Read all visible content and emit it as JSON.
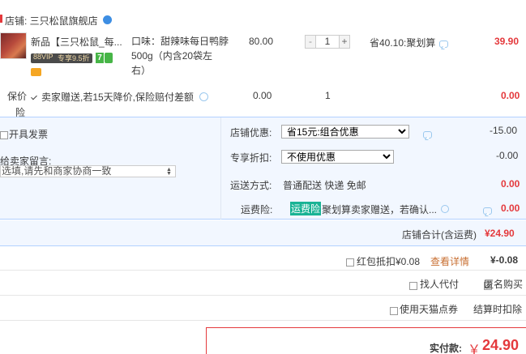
{
  "shop": {
    "label": "店铺: 三只松鼠旗舰店"
  },
  "item": {
    "title": "新品【三只松鼠_每...",
    "vip_badge": "88VIP",
    "vip_text": "专享9.5折",
    "badge_7": "7",
    "sku_lines": [
      "口味：甜辣味每日鸭脖",
      "500g（内含20袋左",
      "右）"
    ],
    "price": "80.00",
    "qty": "1",
    "qty_minus": "-",
    "qty_plus": "+",
    "discount": "省40.10:聚划算",
    "subtotal": "39.90"
  },
  "insurance": {
    "label_line1": "保价",
    "label_line2": "险",
    "text": "卖家赠送,若15天降价,保险赔付差额",
    "price": "0.00",
    "qty": "1",
    "subtotal": "0.00"
  },
  "left": {
    "invoice_label": "开具发票",
    "message_label": "给卖家留言:",
    "message_placeholder": "选填,请先和商家协商一致"
  },
  "right": {
    "shop_discount_label": "店铺优惠:",
    "shop_discount_value": "省15元:组合优惠",
    "shop_discount_amount": "-15.00",
    "exclusive_label": "专享折扣:",
    "exclusive_value": "不使用优惠",
    "exclusive_amount": "-0.00",
    "shipping_label": "运送方式:",
    "shipping_value": "普通配送 快递 免邮",
    "shipping_amount": "0.00",
    "freight_label": "运费险:",
    "freight_tag": "运费险",
    "freight_text": "聚划算卖家赠送，若确认...",
    "freight_amount": "0.00"
  },
  "shop_total": {
    "label": "店铺合计(含运费)",
    "value": "¥24.90"
  },
  "redpacket": {
    "label": "红包抵扣¥0.08",
    "link": "查看详情",
    "amount": "¥-0.08"
  },
  "options": {
    "proxy_pay": "找人代付",
    "anonymous": "匿名购买",
    "tmall_points": "使用天猫点券",
    "deduct_on_checkout": "结算时扣除"
  },
  "payment": {
    "label": "实付款:",
    "currency": "￥",
    "value": "24.90"
  },
  "colors": {
    "accent_red": "#e4393c",
    "panel_bg": "#f2f7ff",
    "panel_border": "#b2d1ff",
    "tag_green": "#1ab394"
  }
}
